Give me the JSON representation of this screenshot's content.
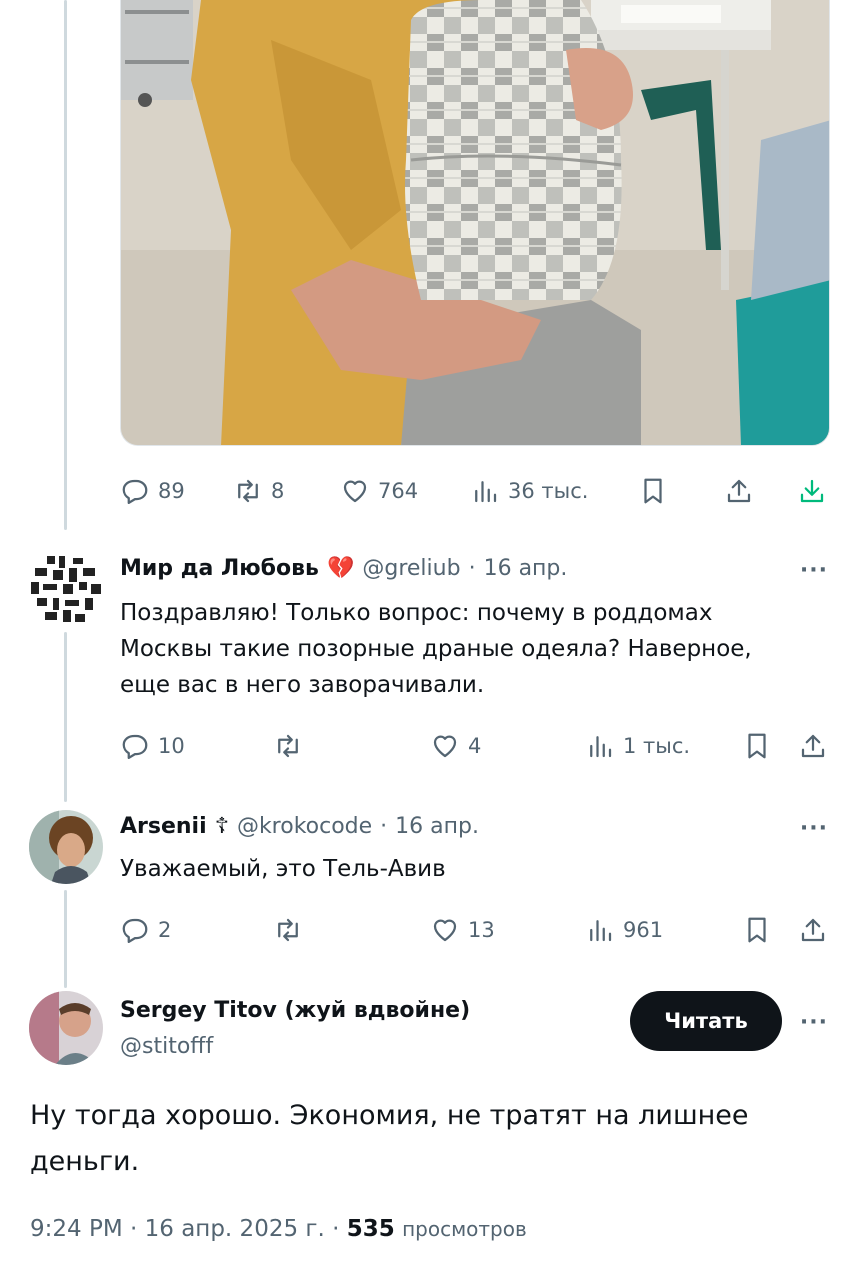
{
  "root_tweet": {
    "stats": {
      "replies": "89",
      "retweets": "8",
      "likes": "764",
      "views": "36 тыс."
    }
  },
  "replies": [
    {
      "name": "Мир да Любовь",
      "name_emoji": "💔",
      "handle": "@greliub",
      "sep": "·",
      "date": "16 апр.",
      "text_lines": [
        "Поздравляю! Только вопрос: почему в роддомах",
        "Москвы такие позорные драные одеяла? Наверное,",
        "еще вас в него заворачивали."
      ],
      "stats": {
        "replies": "10",
        "retweets": "",
        "likes": "4",
        "views": "1 тыс."
      }
    },
    {
      "name": "Arsenii",
      "name_emoji": "☦",
      "handle": "@krokocode",
      "sep": "·",
      "date": "16 апр.",
      "text_lines": [
        "Уважаемый, это Тель-Авив"
      ],
      "stats": {
        "replies": "2",
        "retweets": "",
        "likes": "13",
        "views": "961"
      }
    }
  ],
  "focused": {
    "name": "Sergey Titov (жуй вдвойне)",
    "handle": "@stitofff",
    "follow_label": "Читать",
    "text_line1": "Ну тогда хорошо. Экономия, не тратят на лишнее",
    "text_line2": "деньги.",
    "time": "9:24 PM",
    "sep": "·",
    "date": "16 апр. 2025 г.",
    "views_count": "535",
    "views_label": "просмотров"
  },
  "more_label": "···",
  "icons": {
    "reply": "reply-icon",
    "retweet": "retweet-icon",
    "like": "heart-icon",
    "views": "views-bar-icon",
    "bookmark": "bookmark-icon",
    "share": "share-icon",
    "download": "download-icon"
  },
  "colors": {
    "text": "#0f1419",
    "muted": "#536471",
    "thread_line": "#cfd9de",
    "download_accent": "#00ba7c"
  }
}
